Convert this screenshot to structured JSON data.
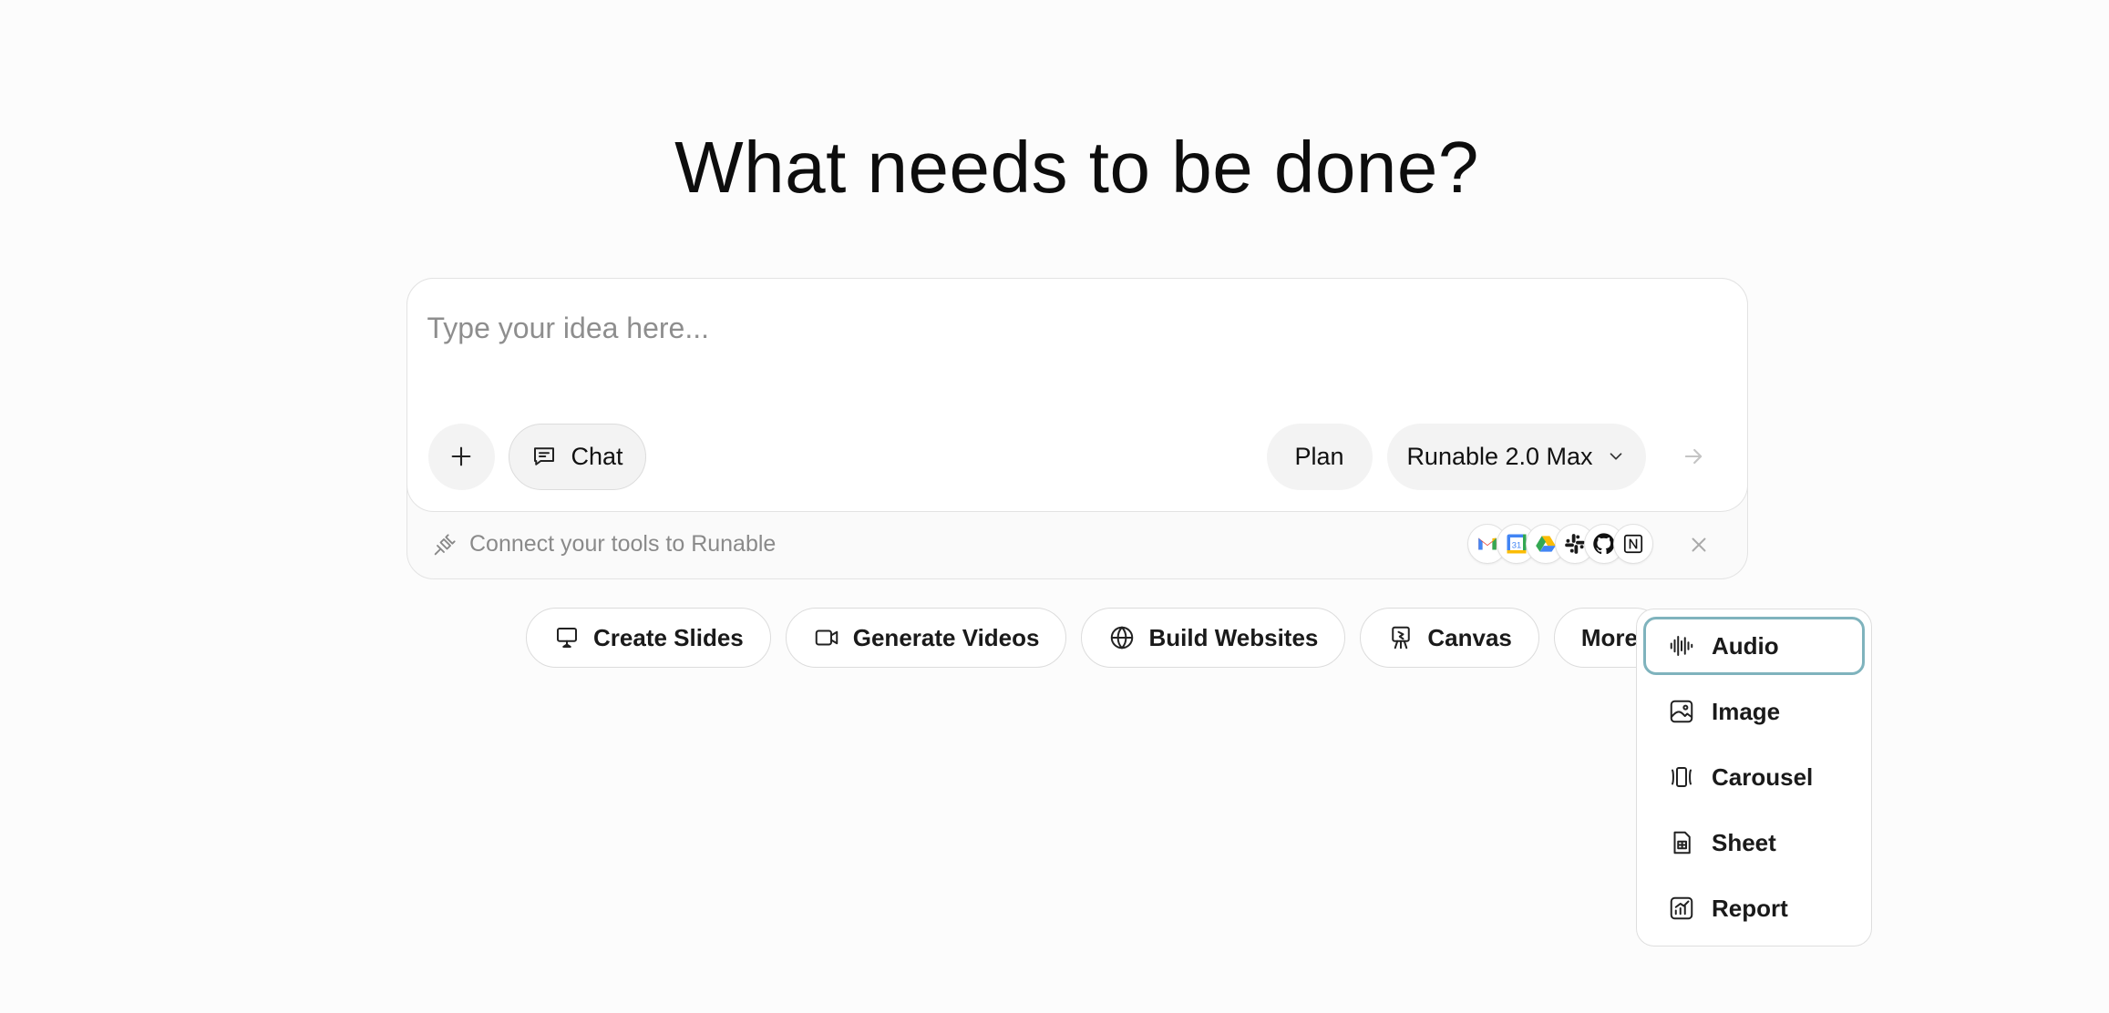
{
  "headline": "What needs to be done?",
  "composer": {
    "placeholder": "Type your idea here...",
    "chat_label": "Chat",
    "plan_label": "Plan",
    "model_label": "Runable 2.0 Max",
    "connect_text": "Connect your tools to Runable",
    "tools": [
      "gmail-icon",
      "google-calendar-icon",
      "google-drive-icon",
      "slack-icon",
      "github-icon",
      "notion-icon"
    ],
    "calendar_day": "31"
  },
  "chips": [
    {
      "icon": "slides-icon",
      "label": "Create Slides"
    },
    {
      "icon": "video-icon",
      "label": "Generate Videos"
    },
    {
      "icon": "globe-icon",
      "label": "Build Websites"
    },
    {
      "icon": "canvas-icon",
      "label": "Canvas"
    },
    {
      "label": "More"
    }
  ],
  "menu": {
    "items": [
      {
        "icon": "audio-icon",
        "label": "Audio",
        "active": true
      },
      {
        "icon": "image-icon",
        "label": "Image"
      },
      {
        "icon": "carousel-icon",
        "label": "Carousel"
      },
      {
        "icon": "sheet-icon",
        "label": "Sheet"
      },
      {
        "icon": "report-icon",
        "label": "Report"
      }
    ]
  },
  "colors": {
    "accent_focus": "#7fb3bd",
    "border": "#dcdcdc",
    "placeholder": "#8e8e8e"
  }
}
